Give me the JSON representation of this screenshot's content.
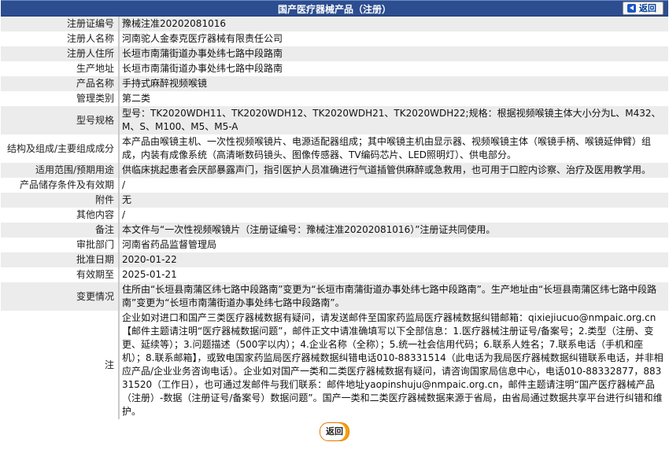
{
  "header": {
    "title": "国产医疗器械产品（注册）",
    "back_label": "返回"
  },
  "rows": [
    {
      "label": "注册证编号",
      "value": "豫械注准20202081016"
    },
    {
      "label": "注册人名称",
      "value": "河南驼人金泰克医疗器械有限责任公司"
    },
    {
      "label": "注册人住所",
      "value": "长垣市南蒲街道办事处纬七路中段路南"
    },
    {
      "label": "生产地址",
      "value": "长垣市南蒲街道办事处纬七路中段路南"
    },
    {
      "label": "产品名称",
      "value": "手持式麻醉视频喉镜"
    },
    {
      "label": "管理类别",
      "value": "第二类"
    },
    {
      "label": "型号规格",
      "value": "型号：TK2020WDH11、TK2020WDH12、TK2020WDH21、TK2020WDH22;规格：根据视频喉镜主体大小分为L、M432、M、S、M100、M5、M5-A"
    },
    {
      "label": "结构及组成/主要组成成分",
      "value": "本产品由喉镜主机、一次性视频喉镜片、电源适配器组成；其中喉镜主机由显示器、视频喉镜主体（喉镜手柄、喉镜延伸臂）组成，内装有成像系统（高清晰数码镜头、图像传感器、TV编码芯片、LED照明灯）、供电部分。"
    },
    {
      "label": "适用范围/预期用途",
      "value": "供临床挑起患者会厌部暴露声门，指引医护人员准确进行气道插管供麻醉或急救用，也可用于口腔内诊察、治疗及医用教学用。"
    },
    {
      "label": "产品储存条件及有效期",
      "value": "/"
    },
    {
      "label": "附件",
      "value": "无"
    },
    {
      "label": "其他内容",
      "value": "/"
    },
    {
      "label": "备注",
      "value": "本文件与“一次性视频喉镜片（注册证编号：豫械注准20202081016）”注册证共同使用。"
    },
    {
      "label": "审批部门",
      "value": "河南省药品监督管理局"
    },
    {
      "label": "批准日期",
      "value": "2020-01-22"
    },
    {
      "label": "有效期至",
      "value": "2025-01-21"
    },
    {
      "label": "变更情况",
      "value": "住所由“长垣县南蒲区纬七路中段路南”变更为“长垣市南蒲街道办事处纬七路中段路南”。生产地址由“长垣县南蒲区纬七路中段路南”变更为“长垣市南蒲街道办事处纬七路中段路南”。"
    },
    {
      "label": "注",
      "value": "企业如对进口和国产三类医疗器械数据有疑问，请发送邮件至国家药监局医疗器械数据纠错邮箱：qixiejiucuo@nmpaic.org.cn【邮件主题请注明“医疗器械数据问题”，邮件正文中请准确填写以下全部信息：1.医疗器械注册证号/备案号；2.类型（注册、变更、延续等）；3.问题描述（500字以内）；4.企业名称（全称）；5.统一社会信用代码；6.联系人姓名；7.联系电话（手机和座机）；8.联系邮箱】，或致电国家药监局医疗器械数据纠错电话010-88331514（此电话为我局医疗器械数据纠错联系电话，并非相应产品/企业业务咨询电话）。企业如对国产一类和二类医疗器械数据有疑问，请咨询国家局信息中心，电话010-88332877，88331520（工作日），也可通过发邮件与我们联系：邮件地址yaopinshuju@nmpaic.org.cn，邮件主题请注明“国产医疗器械产品（注册）-数据（注册证号/备案号）数据问题”。国产一类和二类医疗器械数据来源于省局，由省局通过数据共享平台进行纠错和维护。"
    }
  ],
  "footer": {
    "back_label": "返回"
  }
}
